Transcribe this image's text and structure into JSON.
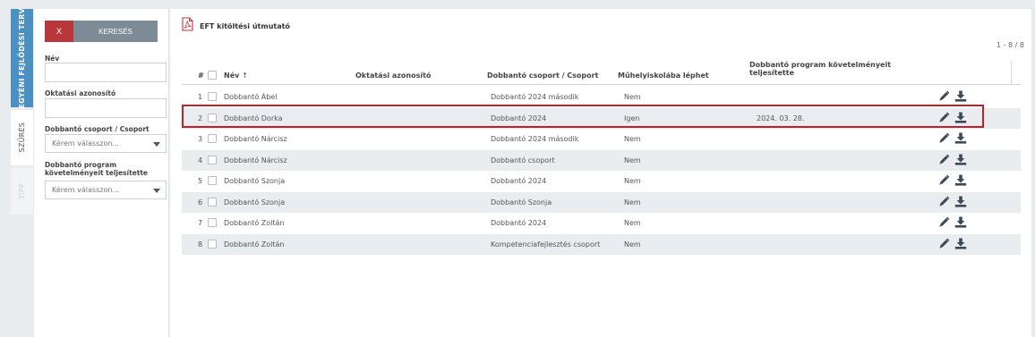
{
  "sidebar_tabs": [
    {
      "label": "EGYÉNI FEJLŐDÉSI TERV"
    },
    {
      "label": "SZŰRÉS"
    },
    {
      "label": "TIPP"
    }
  ],
  "filters": {
    "clear_button": "X",
    "search_button": "KERESÉS",
    "name_label": "Név",
    "name_value": "",
    "edu_id_label": "Oktatási azonosító",
    "edu_id_value": "",
    "group_label": "Dobbantó csoport / Csoport",
    "group_placeholder": "Kérem válasszon...",
    "completion_label": "Dobbantó program követelményeit teljesítette",
    "completion_placeholder": "Kérem válasszon..."
  },
  "main": {
    "doc_title": "EFT kitöltési útmutató",
    "pager": "1 - 8 / 8",
    "columns": {
      "num": "#",
      "name": "Név",
      "sort_indicator": "↑",
      "edu_id": "Oktatási azonosító",
      "group": "Dobbantó csoport / Csoport",
      "workshop": "Műhelyiskolába léphet",
      "completed": "Dobbantó program követelményeit teljesítette"
    },
    "rows": [
      {
        "num": "1",
        "name": "Dobbantó Ábel",
        "edu_id": "",
        "group": "Dobbantó 2024 második",
        "workshop": "Nem",
        "completed": ""
      },
      {
        "num": "2",
        "name": "Dobbantó Dorka",
        "edu_id": "",
        "group": "Dobbantó 2024",
        "workshop": "Igen",
        "completed": "2024. 03. 28."
      },
      {
        "num": "3",
        "name": "Dobbantó Nárcisz",
        "edu_id": "",
        "group": "Dobbantó 2024 második",
        "workshop": "Nem",
        "completed": ""
      },
      {
        "num": "4",
        "name": "Dobbantó Nárcisz",
        "edu_id": "",
        "group": "Dobbantó csoport",
        "workshop": "Nem",
        "completed": ""
      },
      {
        "num": "5",
        "name": "Dobbantó Szonja",
        "edu_id": "",
        "group": "Dobbantó 2024",
        "workshop": "Nem",
        "completed": ""
      },
      {
        "num": "6",
        "name": "Dobbantó Szonja",
        "edu_id": "",
        "group": "Dobbantó Szonja",
        "workshop": "Nem",
        "completed": ""
      },
      {
        "num": "7",
        "name": "Dobbantó Zoltán",
        "edu_id": "",
        "group": "Dobbantó 2024",
        "workshop": "Nem",
        "completed": ""
      },
      {
        "num": "8",
        "name": "Dobbantó Zoltán",
        "edu_id": "",
        "group": "Kompetenciafejlesztés csoport",
        "workshop": "Nem",
        "completed": ""
      }
    ]
  },
  "icons": {
    "edit": "pencil-icon",
    "download": "download-icon",
    "document": "pdf-icon"
  },
  "colors": {
    "tab_active": "#4a90c2",
    "clear_button": "#b9373b",
    "search_button": "#7d8b97",
    "highlight": "#c81e25"
  }
}
